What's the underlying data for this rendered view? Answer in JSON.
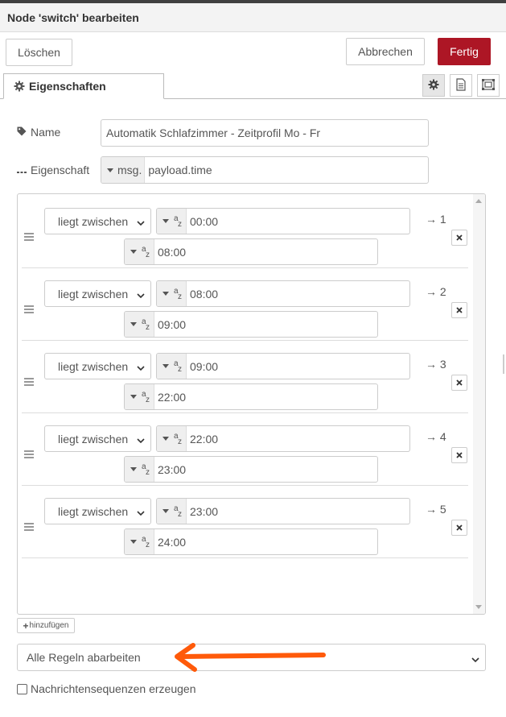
{
  "header": {
    "title": "Node 'switch' bearbeiten"
  },
  "toolbar": {
    "delete_label": "Löschen",
    "cancel_label": "Abbrechen",
    "done_label": "Fertig"
  },
  "tabs": {
    "properties_label": "Eigenschaften"
  },
  "form": {
    "name_label": "Name",
    "name_value": "Automatik Schlafzimmer - Zeitprofil Mo - Fr",
    "property_label": "Eigenschaft",
    "property_type": "msg.",
    "property_value": "payload.time"
  },
  "rules": [
    {
      "operator": "liegt zwischen",
      "from": "00:00",
      "to": "08:00",
      "output": "→ 1"
    },
    {
      "operator": "liegt zwischen",
      "from": "08:00",
      "to": "09:00",
      "output": "→ 2"
    },
    {
      "operator": "liegt zwischen",
      "from": "09:00",
      "to": "22:00",
      "output": "→ 3"
    },
    {
      "operator": "liegt zwischen",
      "from": "22:00",
      "to": "23:00",
      "output": "→ 4"
    },
    {
      "operator": "liegt zwischen",
      "from": "23:00",
      "to": "24:00",
      "output": "→ 5"
    }
  ],
  "add_label": "hinzufügen",
  "mode": {
    "selected": "Alle Regeln abarbeiten"
  },
  "sequence": {
    "label": "Nachrichtensequenzen erzeugen"
  },
  "colors": {
    "accent": "#ad1625",
    "annotation_arrow": "#ff5a0a"
  },
  "icons": {
    "tab": "gear-icon",
    "name": "tag-icon",
    "property": "ellipsis-icon",
    "settings": "gear-icon",
    "description": "document-icon",
    "appearance": "frame-icon"
  }
}
